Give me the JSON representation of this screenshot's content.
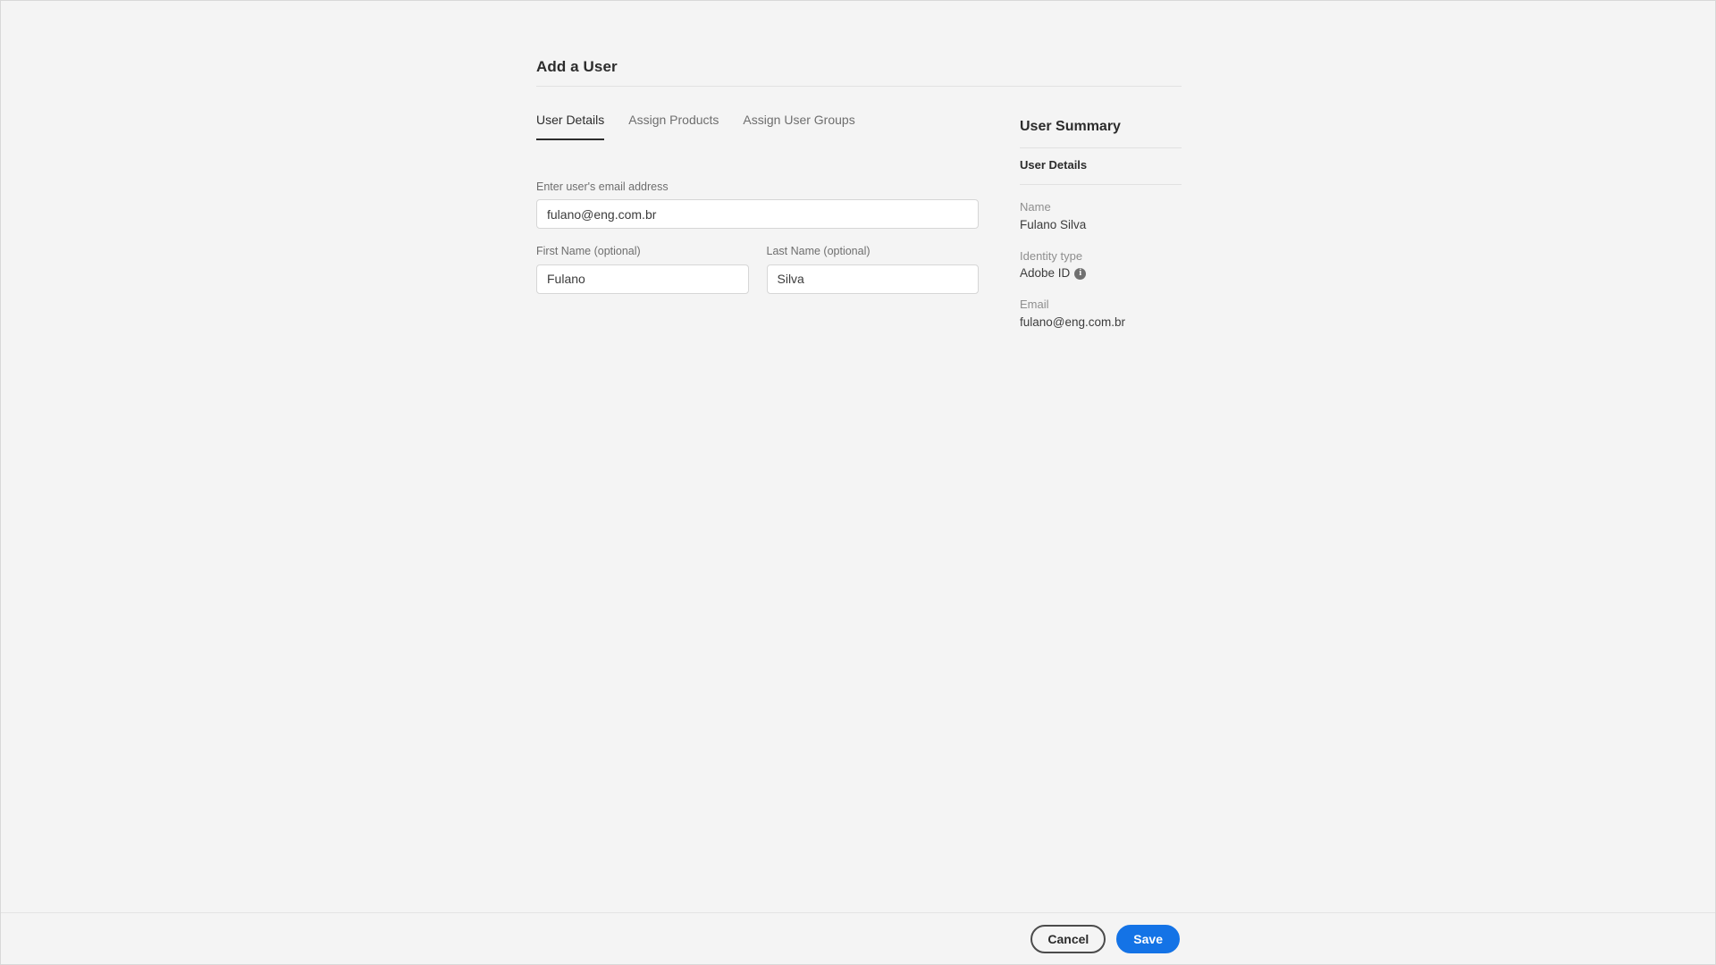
{
  "page": {
    "title": "Add a User"
  },
  "tabs": [
    {
      "label": "User Details",
      "active": true
    },
    {
      "label": "Assign Products",
      "active": false
    },
    {
      "label": "Assign User Groups",
      "active": false
    }
  ],
  "form": {
    "email": {
      "label": "Enter user's email address",
      "value": "fulano@eng.com.br",
      "placeholder": "Enter user's email address"
    },
    "first_name": {
      "label": "First Name (optional)",
      "value": "Fulano",
      "placeholder": "First Name"
    },
    "last_name": {
      "label": "Last Name (optional)",
      "value": "Silva",
      "placeholder": "Last Name"
    }
  },
  "summary": {
    "title": "User Summary",
    "section_title": "User Details",
    "rows": [
      {
        "key": "Name",
        "value": "Fulano Silva"
      },
      {
        "key": "Identity type",
        "value": "Adobe ID",
        "icon": "info-icon"
      },
      {
        "key": "Email",
        "value": "fulano@eng.com.br"
      }
    ]
  },
  "footer": {
    "cancel_label": "Cancel",
    "save_label": "Save"
  },
  "colors": {
    "accent": "#1473E6",
    "background": "#F4F4F4",
    "text": "#2C2C2C",
    "muted_text": "#6E6E6E",
    "border": "#D6D6D6"
  }
}
